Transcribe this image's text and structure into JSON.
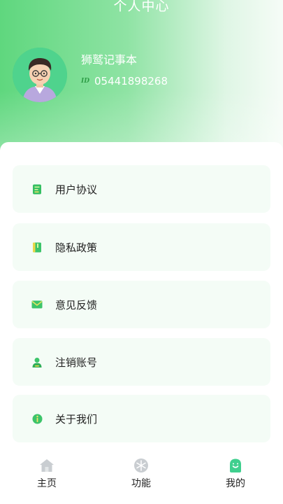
{
  "header": {
    "title": "个人中心",
    "user_name": "狮鹫记事本",
    "id_tag": "ID",
    "user_id": "05441898268"
  },
  "menu": {
    "items": [
      {
        "label": "用户协议",
        "icon": "document-icon"
      },
      {
        "label": "隐私政策",
        "icon": "book-icon"
      },
      {
        "label": "意见反馈",
        "icon": "mail-icon"
      },
      {
        "label": "注销账号",
        "icon": "person-icon"
      },
      {
        "label": "关于我们",
        "icon": "info-icon"
      }
    ]
  },
  "tabbar": {
    "tabs": [
      {
        "label": "主页",
        "icon": "home-icon"
      },
      {
        "label": "功能",
        "icon": "snowflake-icon"
      },
      {
        "label": "我的",
        "icon": "profile-icon",
        "active": true
      }
    ]
  },
  "colors": {
    "accent_green": "#5fd77e",
    "icon_green": "#3cc46a",
    "inactive_icon": "#c8ccd0"
  }
}
